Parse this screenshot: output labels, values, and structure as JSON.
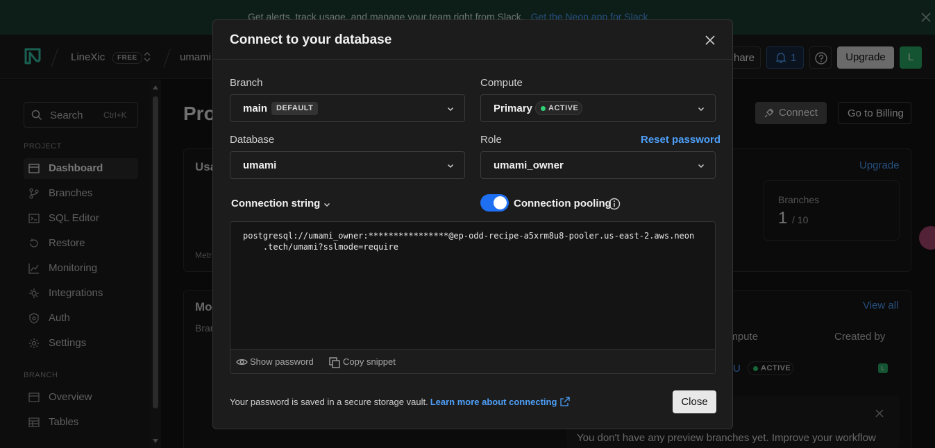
{
  "banner": {
    "text": "Get alerts, track usage, and manage your team right from Slack.",
    "link": "Get the Neon app for Slack"
  },
  "topbar": {
    "org": "LineXic",
    "plan_badge": "FREE",
    "project": "umami",
    "share_label": "hare",
    "notification_count": "1",
    "upgrade_label": "Upgrade",
    "avatar_initial": "L"
  },
  "sidebar": {
    "search_label": "Search",
    "search_shortcut": "Ctrl+K",
    "project_section": "PROJECT",
    "project_items": [
      "Dashboard",
      "Branches",
      "SQL Editor",
      "Restore",
      "Monitoring",
      "Integrations",
      "Auth",
      "Settings"
    ],
    "branch_section": "BRANCH",
    "branch_items": [
      "Overview",
      "Tables"
    ]
  },
  "main": {
    "title_fragment": "Pro",
    "connect_label": "Connect",
    "billing_label": "Go to Billing",
    "usage_fragment": "Usa",
    "metrics_fragment": "Metr",
    "upgrade_link": "Upgrade",
    "branches_label": "Branches",
    "branches_value": "1",
    "branches_max": "/ 10",
    "monitoring_fragment": "Mo",
    "branch_fragment": "Bran",
    "view_all": "View all",
    "col_compute": "ompute",
    "col_created_by": "Created by",
    "row_compute_fragment": "U",
    "row_status": "ACTIVE",
    "row_avatar": "L",
    "preview_text": "You don't have any preview branches yet. Improve your workflow"
  },
  "modal": {
    "title": "Connect to your database",
    "branch_label": "Branch",
    "branch_value": "main",
    "branch_badge": "DEFAULT",
    "compute_label": "Compute",
    "compute_value": "Primary",
    "compute_status": "ACTIVE",
    "database_label": "Database",
    "database_value": "umami",
    "role_label": "Role",
    "role_value": "umami_owner",
    "reset_password": "Reset password",
    "connection_string_label": "Connection string",
    "pooling_label": "Connection pooling",
    "pooling_enabled": true,
    "connection_string_line1": "postgresql://umami_owner:****************@ep-odd-recipe-a5xrm8u8-pooler.us-east-2.aws.neon",
    "connection_string_line2": "    .tech/umami?sslmode=require",
    "show_password": "Show password",
    "copy_snippet": "Copy snippet",
    "vault_text": "Your password is saved in a secure storage vault.",
    "learn_more": "Learn more about connecting",
    "close_label": "Close"
  },
  "colors": {
    "accent_blue": "#4d9ff8",
    "toggle_blue": "#1e6ff2",
    "active_green": "#2fce75",
    "avatar_green": "#2aa864"
  }
}
